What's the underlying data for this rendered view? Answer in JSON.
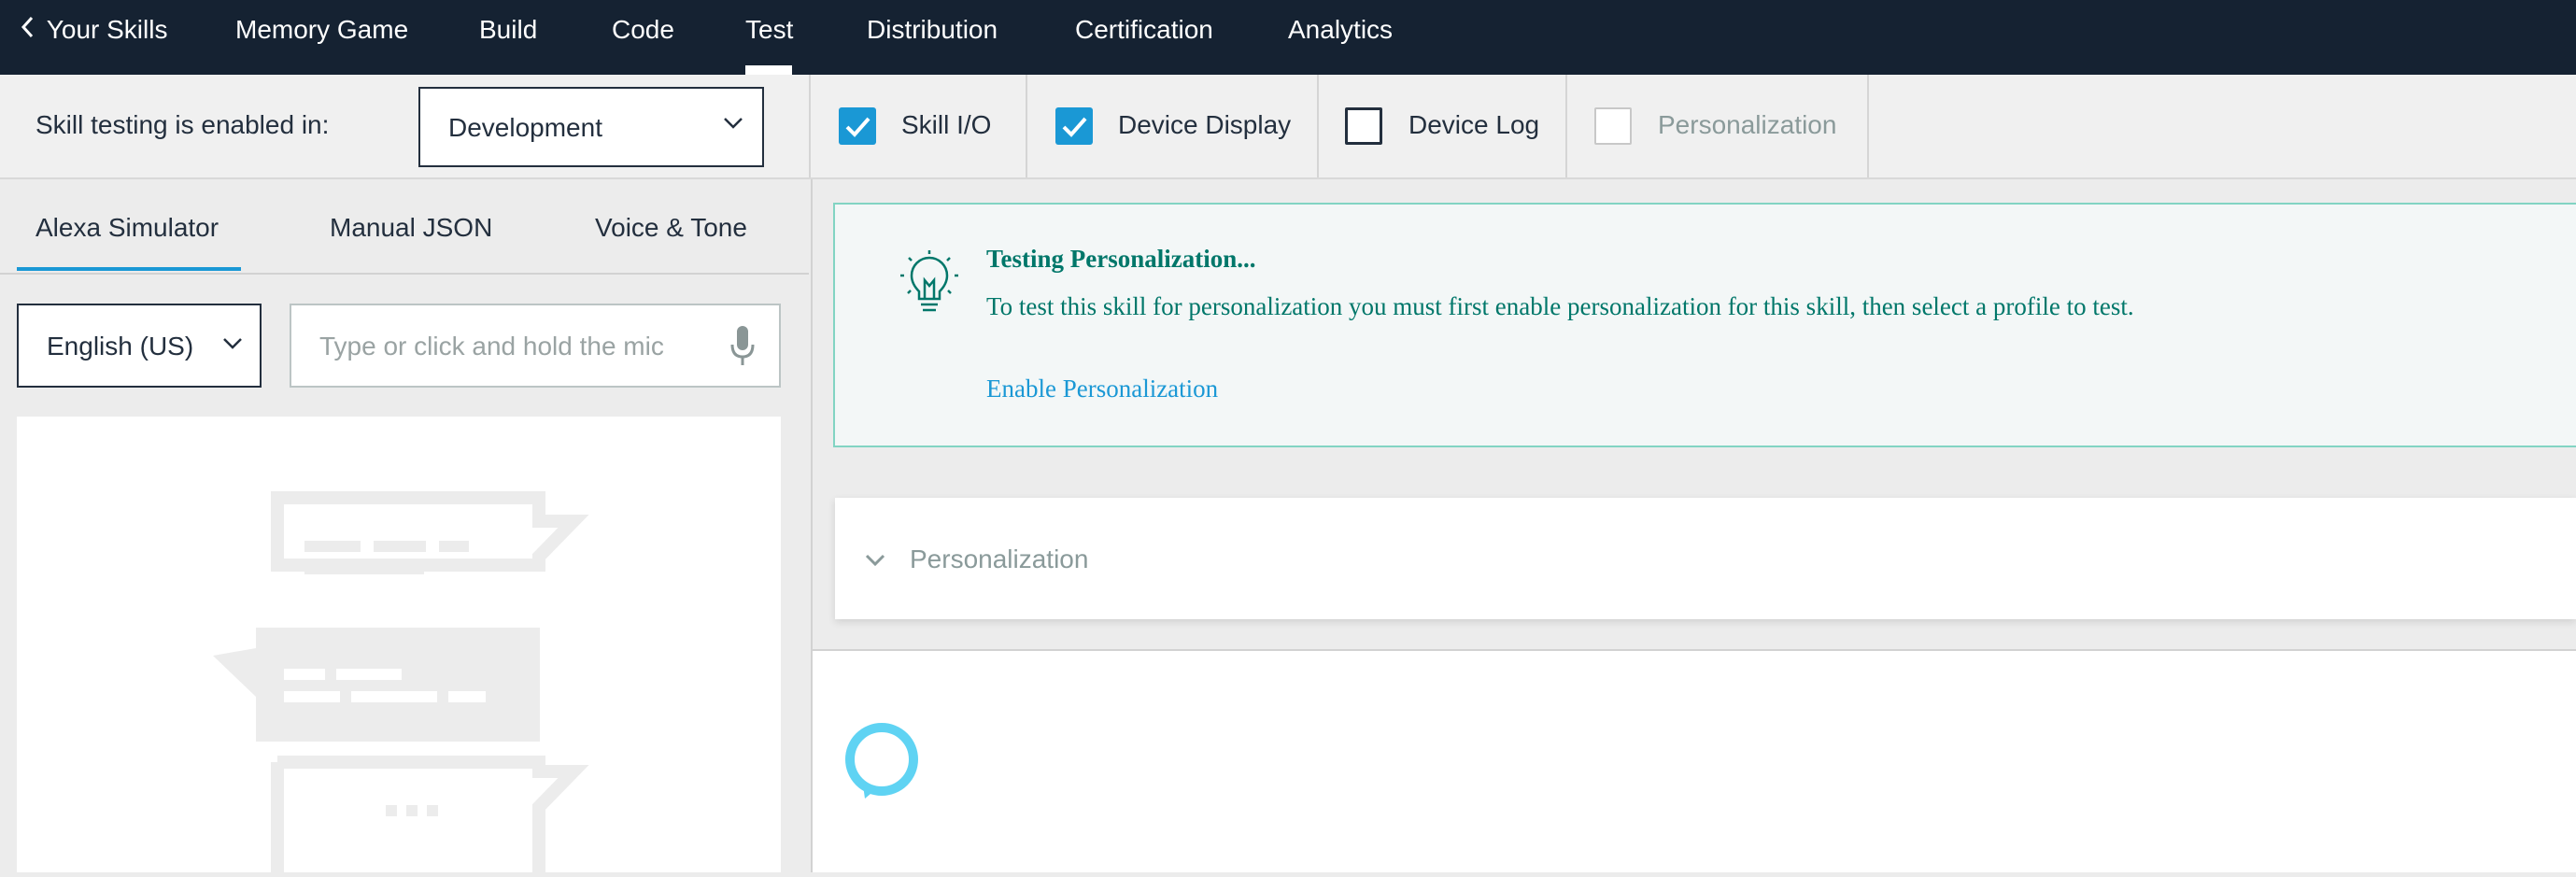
{
  "nav": {
    "back_label": "Your Skills",
    "skill_name": "Memory Game",
    "tabs": [
      "Build",
      "Code",
      "Test",
      "Distribution",
      "Certification",
      "Analytics"
    ],
    "active_tab": "Test"
  },
  "toolbar": {
    "testing_label": "Skill testing is enabled in:",
    "stage_select": "Development",
    "checkboxes": [
      {
        "label": "Skill I/O",
        "state": "checked"
      },
      {
        "label": "Device Display",
        "state": "checked"
      },
      {
        "label": "Device Log",
        "state": "unchecked"
      },
      {
        "label": "Personalization",
        "state": "disabled"
      }
    ]
  },
  "left": {
    "tabs": [
      "Alexa Simulator",
      "Manual JSON",
      "Voice & Tone"
    ],
    "active_tab": "Alexa Simulator",
    "language_select": "English (US)",
    "utterance_placeholder": "Type or click and hold the mic"
  },
  "alert": {
    "title": "Testing Personalization...",
    "text": "To test this skill for personalization you must first enable personalization for this skill, then select a profile to test.",
    "link": "Enable Personalization"
  },
  "accordion": {
    "label": "Personalization"
  },
  "colors": {
    "nav_bg": "#152232",
    "accent": "#1a98d5",
    "alert_text": "#00776a",
    "alert_border": "#82d4c3",
    "alexa_ring": "#5fd3f3"
  }
}
